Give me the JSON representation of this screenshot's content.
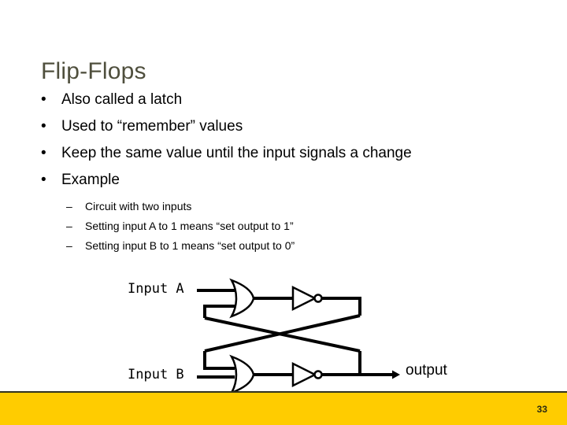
{
  "slide": {
    "title": "Flip-Flops",
    "title_color": "#4f4f3d",
    "background_color": "#ffffff"
  },
  "bullets": [
    {
      "mark": "•",
      "text": "Also called a latch"
    },
    {
      "mark": "•",
      "text": "Used to “remember” values"
    },
    {
      "mark": "•",
      "text": "Keep the same value until the input signals a change"
    },
    {
      "mark": "•",
      "text": "Example"
    }
  ],
  "sub_bullets": [
    {
      "mark": "–",
      "text": "Circuit with two inputs"
    },
    {
      "mark": "–",
      "text": "Setting input A to 1 means “set output to 1”"
    },
    {
      "mark": "–",
      "text": "Setting input B to 1 means “set output to 0”"
    }
  ],
  "circuit": {
    "description": "Cross-coupled NOR latch: two OR gates each followed by an inverter, outputs cross-fed back to the opposite gate input",
    "input_a_label": "Input A",
    "input_b_label": "Input B",
    "output_label": "output",
    "wire_color": "#000000",
    "gate_fill": "#ffffff"
  },
  "footer": {
    "bar_color": "#ffcc00",
    "rule_color": "#32321e",
    "page_number": "33"
  }
}
